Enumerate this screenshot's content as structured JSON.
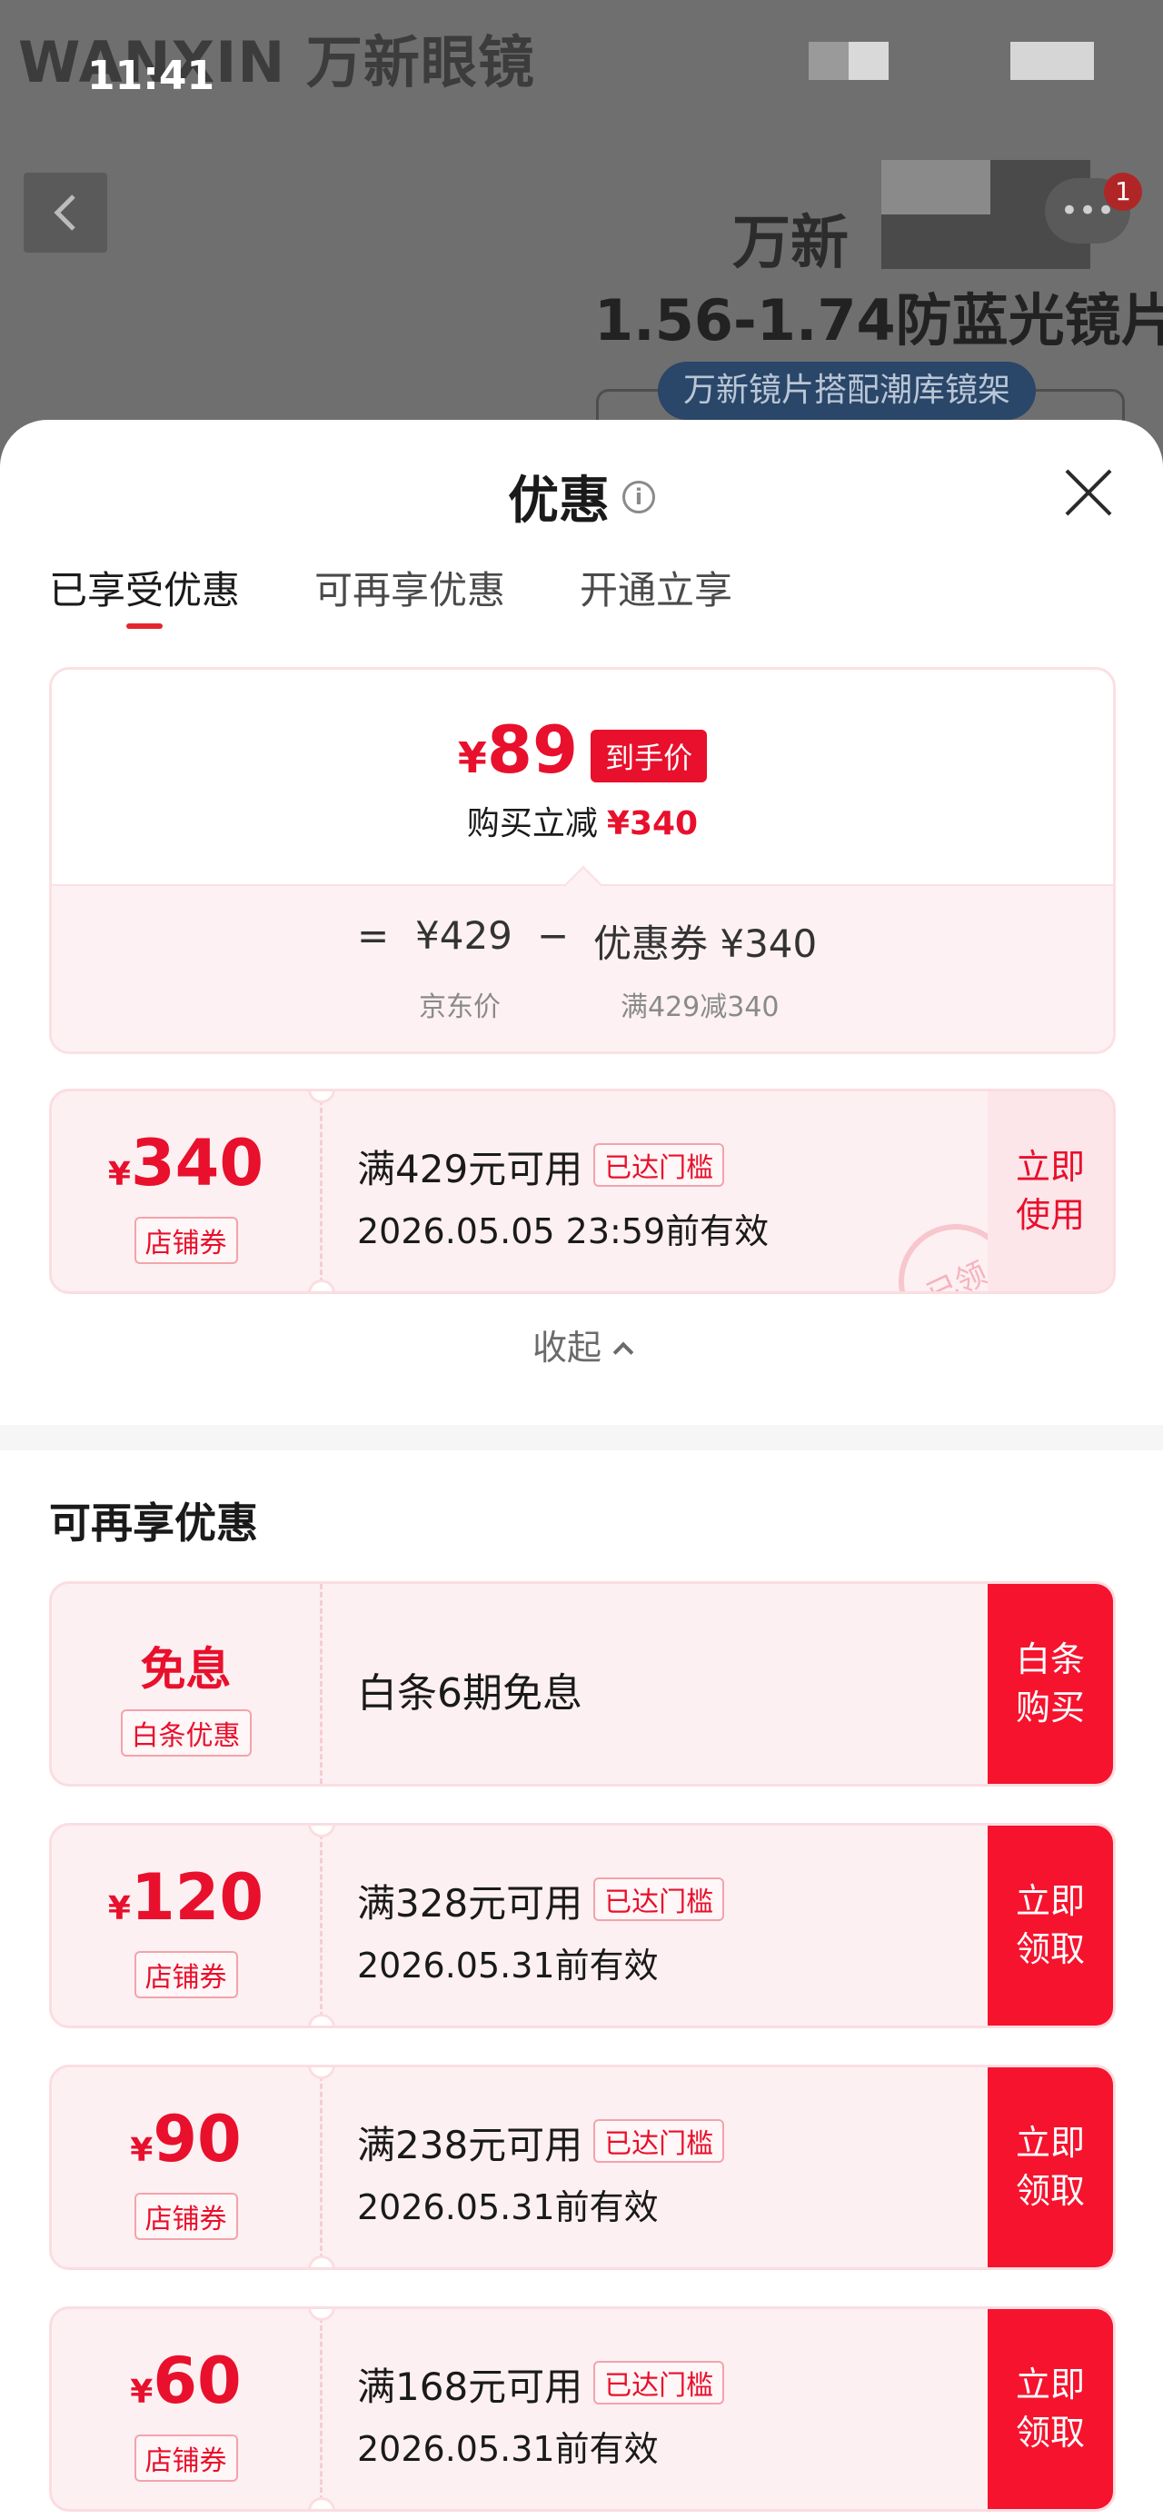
{
  "background": {
    "brand": "WANXIN 万新眼镜",
    "time": "11:41",
    "badge_count": "1",
    "more_label": "•••",
    "head_text": "万新",
    "product_title": "1.56-1.74防蓝光镜片",
    "product_tag": "万新镜片搭配潮库镜架"
  },
  "sheet": {
    "title": "优惠",
    "tabs": [
      "已享受优惠",
      "可再享优惠",
      "开通立享"
    ],
    "summary": {
      "currency": "¥",
      "final_price": "89",
      "final_tag": "到手价",
      "save_label": "购买立减",
      "save_amount": "¥340",
      "equals": "=",
      "base_price": "¥429",
      "minus": "−",
      "coupon_part": "优惠券 ¥340",
      "base_price_label": "京东价",
      "coupon_part_label": "满429减340"
    },
    "applied_coupon": {
      "currency": "¥",
      "amount": "340",
      "type": "店铺券",
      "condition": "满429元可用",
      "met": "已达门槛",
      "valid": "2026.05.05 23:59前有效",
      "button_line1": "立即",
      "button_line2": "使用",
      "stamp": "已领"
    },
    "collapse_label": "收起",
    "more_section_title": "可再享优惠",
    "offers": [
      {
        "kind": "text",
        "amount": "免息",
        "type": "白条优惠",
        "text": "白条6期免息",
        "button_line1": "白条",
        "button_line2": "购买"
      },
      {
        "kind": "coupon",
        "currency": "¥",
        "amount": "120",
        "type": "店铺券",
        "condition": "满328元可用",
        "met": "已达门槛",
        "valid": "2026.05.31前有效",
        "button_line1": "立即",
        "button_line2": "领取"
      },
      {
        "kind": "coupon",
        "currency": "¥",
        "amount": "90",
        "type": "店铺券",
        "condition": "满238元可用",
        "met": "已达门槛",
        "valid": "2026.05.31前有效",
        "button_line1": "立即",
        "button_line2": "领取"
      },
      {
        "kind": "coupon",
        "currency": "¥",
        "amount": "60",
        "type": "店铺券",
        "condition": "满168元可用",
        "met": "已达门槛",
        "valid": "2026.05.31前有效",
        "button_line1": "立即",
        "button_line2": "领取"
      }
    ]
  }
}
